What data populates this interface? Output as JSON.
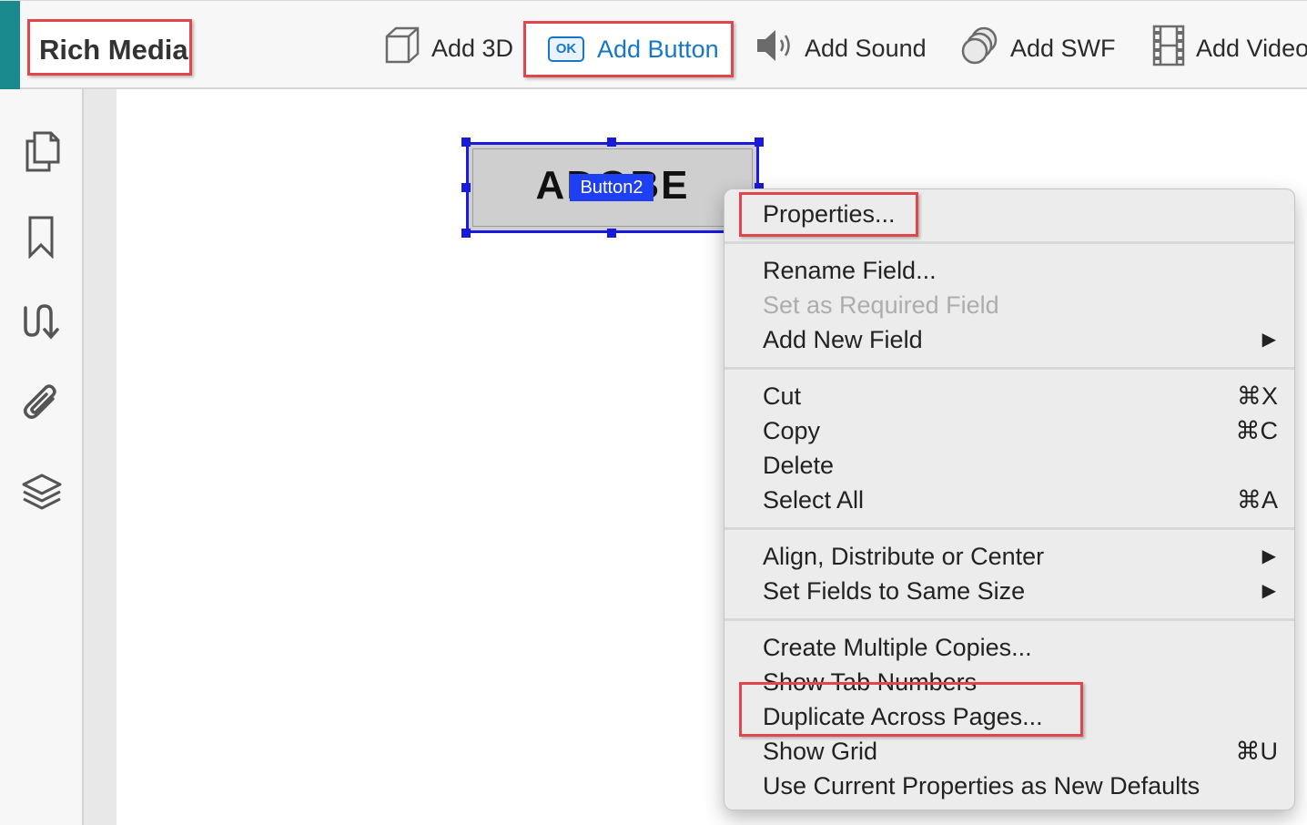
{
  "toolbar": {
    "group_label": "Rich Media",
    "tools": [
      {
        "label": "Add 3D",
        "icon": "cube-icon"
      },
      {
        "label": "Add Button",
        "icon": "ok-button-icon",
        "badge": "OK"
      },
      {
        "label": "Add Sound",
        "icon": "speaker-icon"
      },
      {
        "label": "Add SWF",
        "icon": "swf-icon"
      },
      {
        "label": "Add Video",
        "icon": "film-icon"
      }
    ]
  },
  "left_rail": {
    "icons": [
      "pages-icon",
      "bookmark-icon",
      "signature-icon",
      "attachment-icon",
      "layers-icon"
    ]
  },
  "page": {
    "form_button_text": "ADOBE",
    "field_tag": "Button2"
  },
  "context_menu": {
    "items": [
      {
        "label": "Properties...",
        "shortcut": "",
        "submenu": false,
        "disabled": false
      },
      {
        "label": "Rename Field...",
        "shortcut": "",
        "submenu": false,
        "disabled": false
      },
      {
        "label": "Set as Required Field",
        "shortcut": "",
        "submenu": false,
        "disabled": true
      },
      {
        "label": "Add New Field",
        "shortcut": "",
        "submenu": true,
        "disabled": false
      },
      {
        "label": "Cut",
        "shortcut": "⌘X",
        "submenu": false,
        "disabled": false
      },
      {
        "label": "Copy",
        "shortcut": "⌘C",
        "submenu": false,
        "disabled": false
      },
      {
        "label": "Delete",
        "shortcut": "",
        "submenu": false,
        "disabled": false
      },
      {
        "label": "Select All",
        "shortcut": "⌘A",
        "submenu": false,
        "disabled": false
      },
      {
        "label": "Align, Distribute or Center",
        "shortcut": "",
        "submenu": true,
        "disabled": false
      },
      {
        "label": "Set Fields to Same Size",
        "shortcut": "",
        "submenu": true,
        "disabled": false
      },
      {
        "label": "Create Multiple Copies...",
        "shortcut": "",
        "submenu": false,
        "disabled": false
      },
      {
        "label": "Show Tab Numbers",
        "shortcut": "",
        "submenu": false,
        "disabled": false
      },
      {
        "label": "Duplicate Across Pages...",
        "shortcut": "",
        "submenu": false,
        "disabled": false
      },
      {
        "label": "Show Grid",
        "shortcut": "⌘U",
        "submenu": false,
        "disabled": false
      },
      {
        "label": "Use Current Properties as New Defaults",
        "shortcut": "",
        "submenu": false,
        "disabled": false
      }
    ],
    "submenu_arrow": "▶"
  },
  "colors": {
    "highlight_border": "#e0474c",
    "accent_blue": "#1677c9",
    "selection_blue": "#1a1adb",
    "teal": "#1a8a8f"
  }
}
